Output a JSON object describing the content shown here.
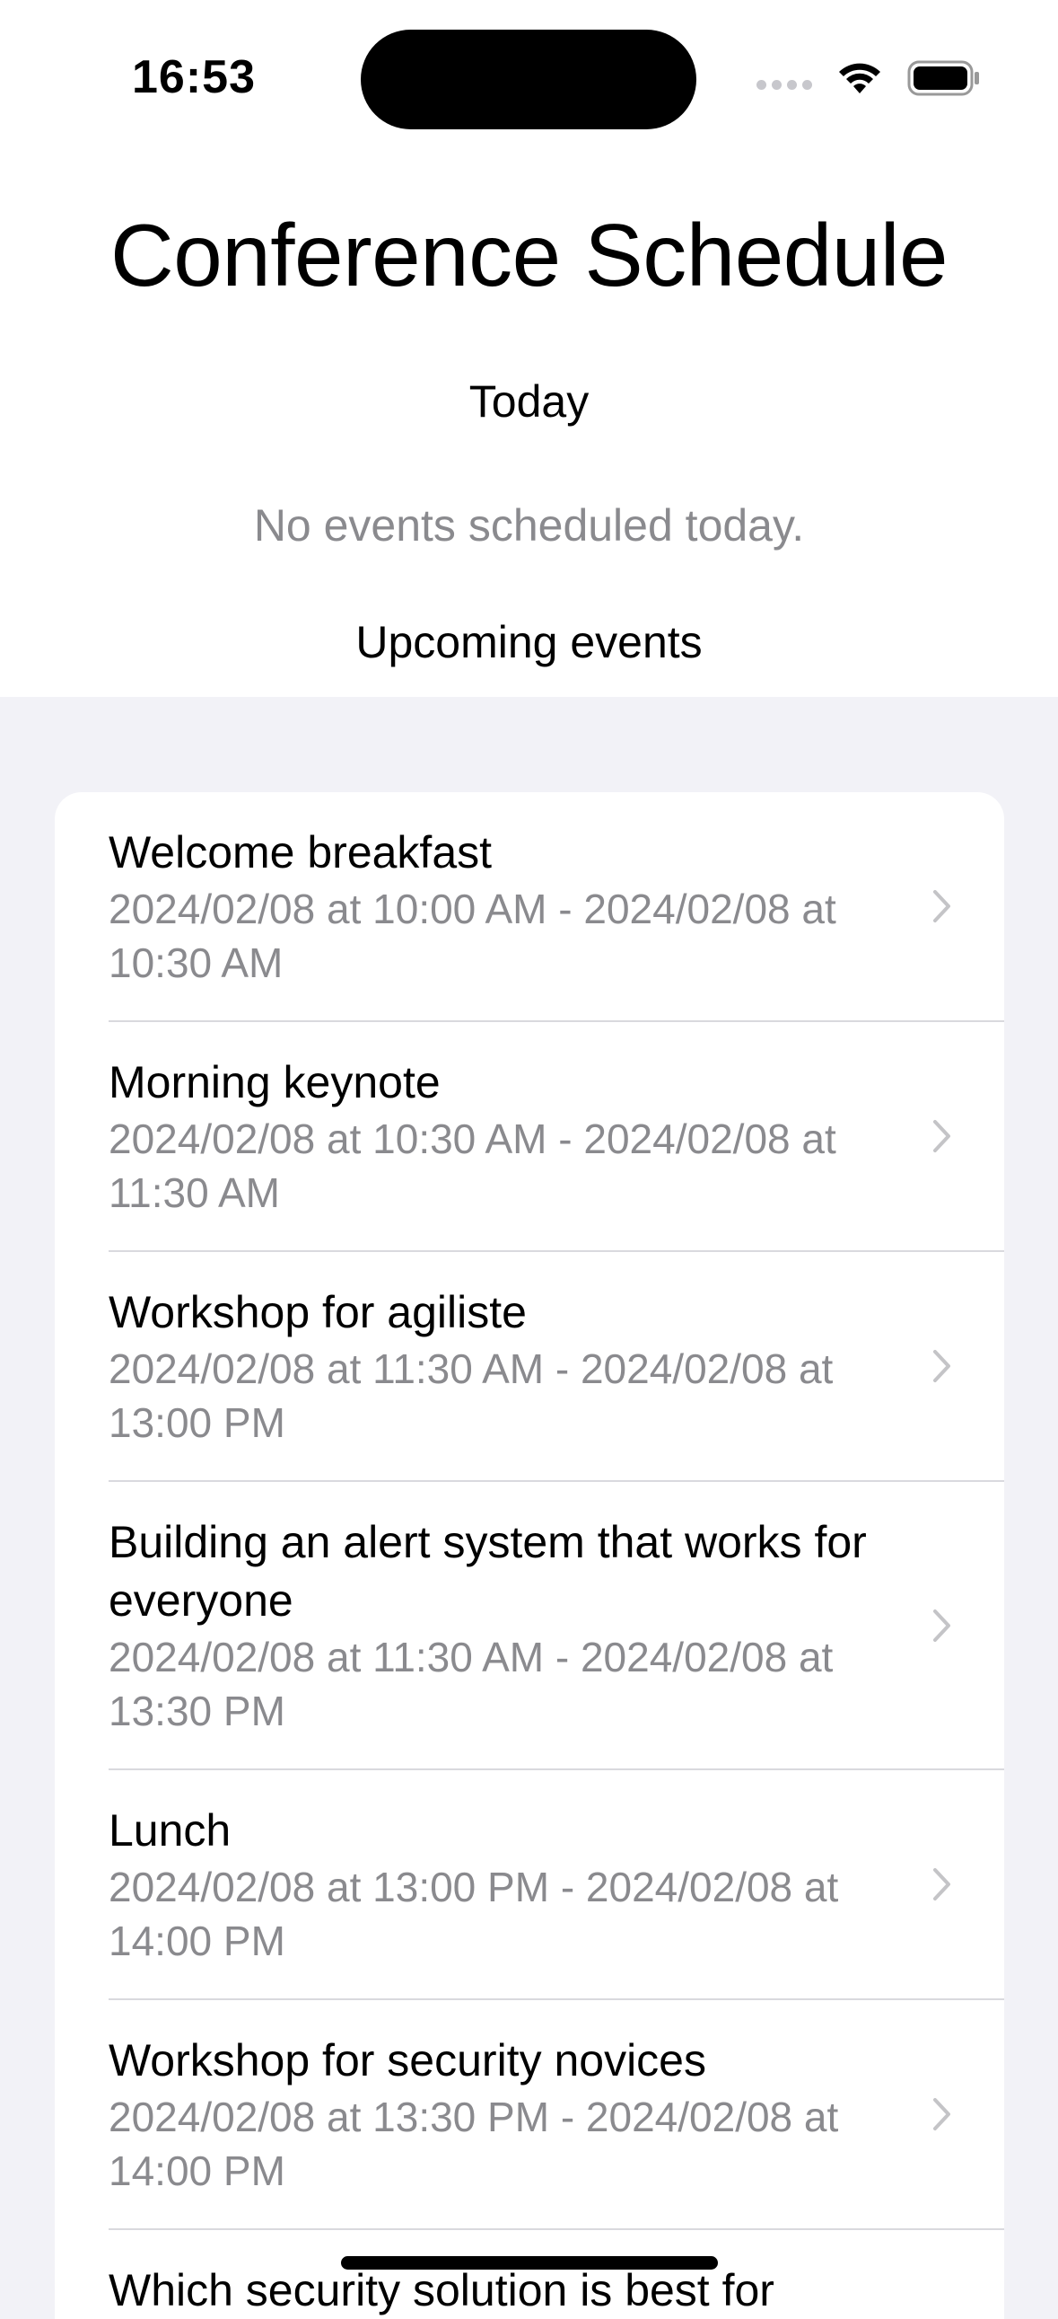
{
  "status_bar": {
    "time": "16:53",
    "icons": [
      "signal-dots-icon",
      "wifi-icon",
      "battery-icon"
    ]
  },
  "header": {
    "title": "Conference Schedule",
    "today_label": "Today",
    "empty_message": "No events scheduled today.",
    "upcoming_label": "Upcoming events"
  },
  "events": [
    {
      "title": "Welcome breakfast",
      "time": "2024/02/08 at 10:00 AM - 2024/02/08 at 10:30 AM"
    },
    {
      "title": "Morning keynote",
      "time": "2024/02/08 at 10:30 AM - 2024/02/08 at 11:30 AM"
    },
    {
      "title": "Workshop for agiliste",
      "time": "2024/02/08 at 11:30 AM - 2024/02/08 at 13:00 PM"
    },
    {
      "title": "Building an alert system that works for everyone",
      "time": "2024/02/08 at 11:30 AM - 2024/02/08 at 13:30 PM"
    },
    {
      "title": "Lunch",
      "time": "2024/02/08 at 13:00 PM - 2024/02/08 at 14:00 PM"
    },
    {
      "title": "Workshop for security novices",
      "time": "2024/02/08 at 13:30 PM - 2024/02/08 at 14:00 PM"
    },
    {
      "title": "Which security solution is best for you?",
      "time": ""
    }
  ],
  "colors": {
    "background": "#f2f2f7",
    "secondary_text": "#8a8a8e",
    "chevron": "#c4c4c7",
    "separator": "#d9d9de"
  }
}
